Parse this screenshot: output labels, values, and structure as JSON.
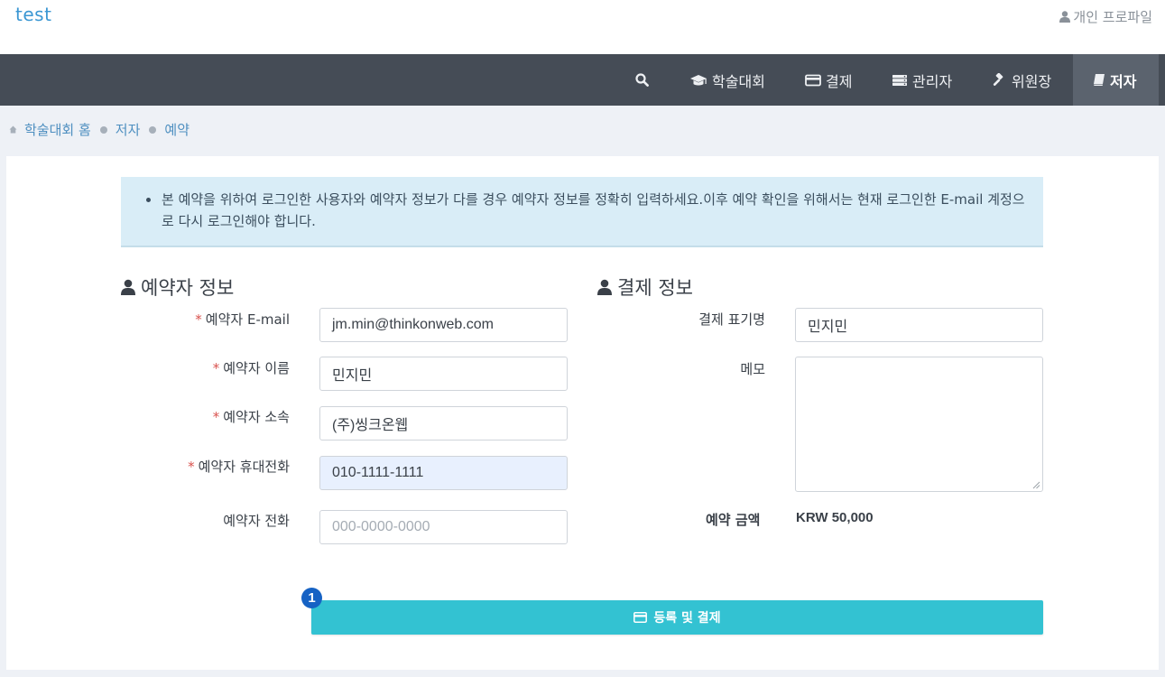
{
  "header": {
    "brand": "test",
    "profile_label": "개인 프로파일"
  },
  "nav": {
    "items": [
      {
        "label": "학술대회",
        "icon": "graduation-cap-icon"
      },
      {
        "label": "결제",
        "icon": "credit-card-icon"
      },
      {
        "label": "관리자",
        "icon": "server-icon"
      },
      {
        "label": "위원장",
        "icon": "gavel-icon"
      },
      {
        "label": "저자",
        "icon": "book-icon",
        "active": true
      }
    ]
  },
  "breadcrumb": [
    "학술대회 홈",
    "저자",
    "예약"
  ],
  "alert": {
    "message": "본 예약을 위하여 로그인한 사용자와 예약자 정보가 다를 경우 예약자 정보를 정확히 입력하세요.이후 예약 확인을 위해서는 현재 로그인한 E-mail 계정으로 다시 로그인해야 합니다."
  },
  "booker": {
    "title": "예약자 정보",
    "fields": [
      {
        "label": "예약자 E-mail",
        "required": true,
        "value": "jm.min@thinkonweb.com"
      },
      {
        "label": "예약자 이름",
        "required": true,
        "value": "민지민"
      },
      {
        "label": "예약자 소속",
        "required": true,
        "value": "(주)씽크온웹"
      },
      {
        "label": "예약자 휴대전화",
        "required": true,
        "value": "010-1111-1111"
      },
      {
        "label": "예약자 전화",
        "required": false,
        "value": "",
        "placeholder": "000-0000-0000"
      }
    ]
  },
  "payment": {
    "title": "결제 정보",
    "display_name_label": "결제 표기명",
    "display_name_value": "민지민",
    "memo_label": "메모",
    "memo_value": "",
    "amount_label": "예약 금액",
    "amount_value": "KRW 50,000"
  },
  "submit": {
    "label": "등록 및 결제",
    "step_number": "1"
  },
  "colors": {
    "navbar": "#454c56",
    "accent_button": "#33c2d2",
    "alert_bg": "#d9edf7",
    "step_badge": "#1662c4",
    "required_mark": "#d9534f"
  }
}
